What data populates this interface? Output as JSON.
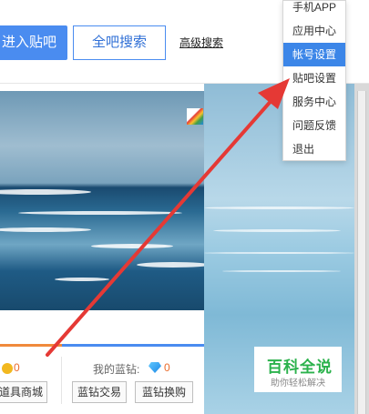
{
  "header": {
    "enter_button": "进入贴吧",
    "search_all_button": "全吧搜索",
    "advanced_search_link": "高级搜索"
  },
  "user_menu": {
    "items": [
      "手机APP",
      "应用中心",
      "帐号设置",
      "贴吧设置",
      "服务中心",
      "问题反馈",
      "退出"
    ],
    "active_index": 2
  },
  "wallet": {
    "coin_value": "0",
    "blue_diamond_label": "我的蓝钻:",
    "blue_diamond_value": "0",
    "mall_button": "道具商城",
    "trade_button": "蓝钻交易",
    "exchange_button": "蓝钻换购"
  },
  "brand": {
    "title": "百科全说",
    "subtitle": "助你轻松解决"
  },
  "colors": {
    "accent": "#4a8cf0",
    "menu_highlight": "#3c86e8",
    "arrow": "#e53935",
    "brand_green": "#2bb24c"
  }
}
